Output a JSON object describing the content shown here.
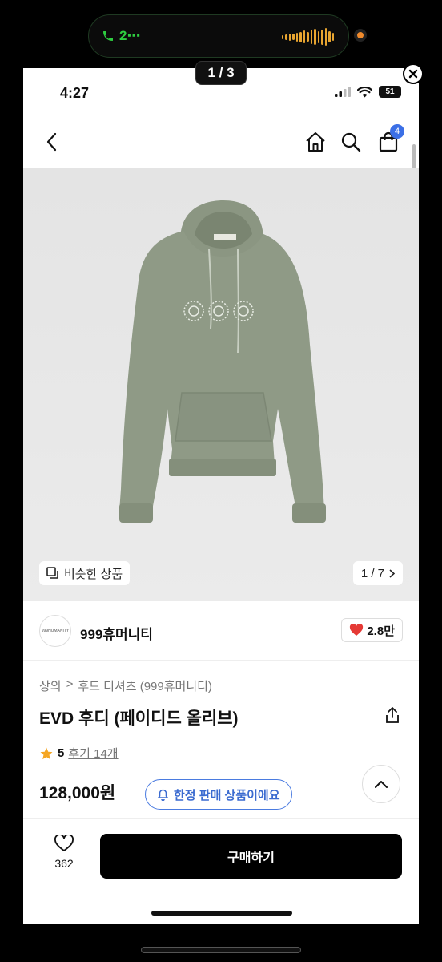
{
  "outer": {
    "call_label": "2⋯",
    "page_counter": "1 / 3"
  },
  "status": {
    "time": "4:27",
    "battery": "51"
  },
  "nav": {
    "cart_count": "4"
  },
  "image": {
    "similar_label": "비슷한 상품",
    "counter": "1 / 7"
  },
  "brand": {
    "logo_text": "999HUMANITY",
    "name": "999휴머니티",
    "likes": "2.8만"
  },
  "product": {
    "breadcrumb": [
      "상의",
      ">",
      "후드 티셔츠 (999휴머니티)"
    ],
    "title": "EVD 후디 (페이디드 올리브)",
    "rating_score": "5",
    "reviews": "후기 14개",
    "price": "128,000원",
    "limited_label": "한정 판매 상품이에요"
  },
  "bottom": {
    "wish_count": "362",
    "buy_label": "구매하기"
  },
  "colors": {
    "accent_blue": "#3b6fe6",
    "heart_red": "#e53935",
    "star": "#f5a623",
    "hoodie": "#8f9a86"
  }
}
